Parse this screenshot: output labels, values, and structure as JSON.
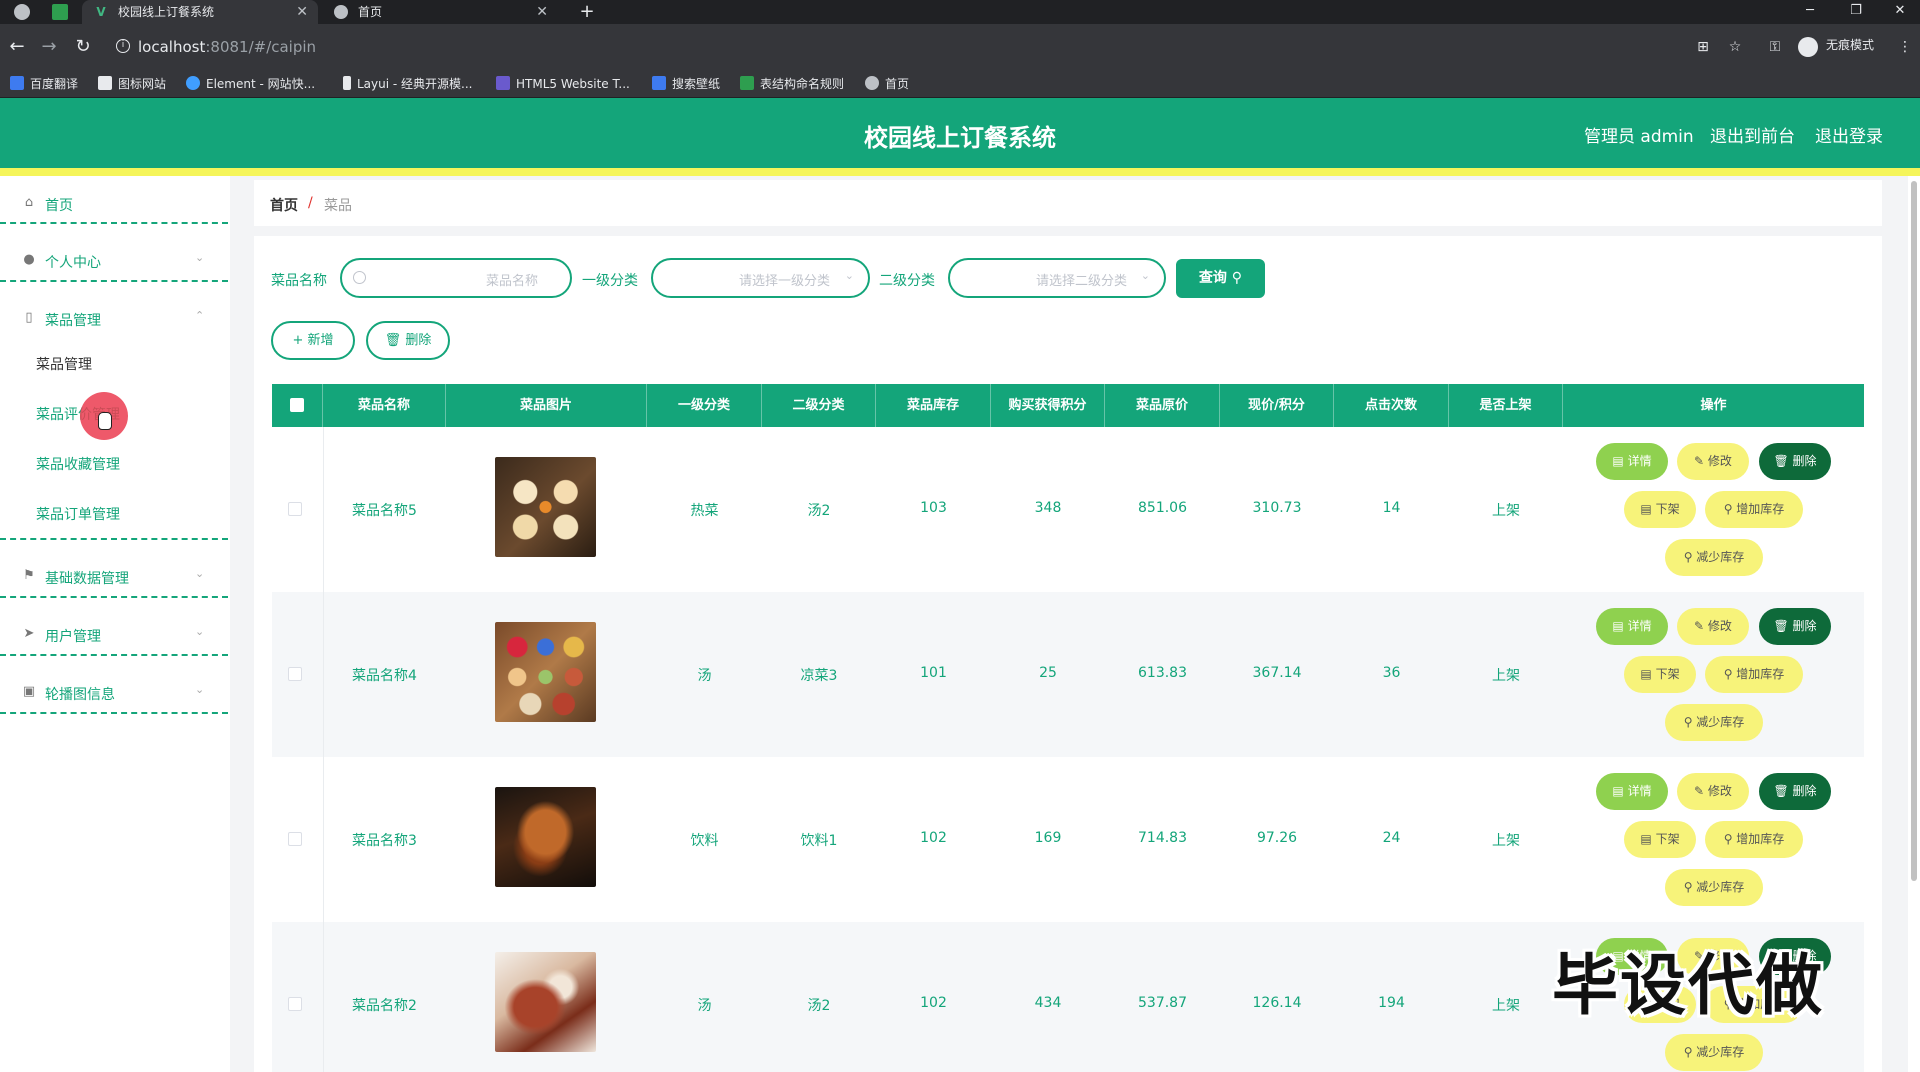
{
  "browser": {
    "tabs": [
      {
        "title": "校园线上订餐系统",
        "active": true
      },
      {
        "title": "首页",
        "active": false
      }
    ],
    "url_host": "localhost",
    "url_rest": ":8081/#/caipin",
    "incognito_label": "无痕模式",
    "bookmarks": [
      "百度翻译",
      "图标网站",
      "Element - 网站快...",
      "Layui - 经典开源模...",
      "HTML5 Website T...",
      "搜索壁纸",
      "表结构命名规则",
      "首页"
    ]
  },
  "header": {
    "title": "校园线上订餐系统",
    "admin": "管理员 admin",
    "to_front": "退出到前台",
    "logout": "退出登录"
  },
  "sidebar": {
    "items": [
      {
        "label": "首页",
        "icon": "home-icon"
      },
      {
        "label": "个人中心",
        "icon": "user-icon"
      },
      {
        "label": "菜品管理",
        "icon": "phone-icon"
      },
      {
        "label": "基础数据管理",
        "icon": "flag-icon"
      },
      {
        "label": "用户管理",
        "icon": "send-icon"
      },
      {
        "label": "轮播图信息",
        "icon": "trash-icon"
      }
    ],
    "sub_items": [
      "菜品管理",
      "菜品评价管理",
      "菜品收藏管理",
      "菜品订单管理"
    ]
  },
  "breadcrumb": {
    "home": "首页",
    "sep": "/",
    "current": "菜品"
  },
  "filters": {
    "name_label": "菜品名称",
    "name_placeholder": "菜品名称",
    "cat1_label": "一级分类",
    "cat1_placeholder": "请选择一级分类",
    "cat2_label": "二级分类",
    "cat2_placeholder": "请选择二级分类",
    "query": "查询"
  },
  "actions": {
    "add": "+ 新增",
    "delete": "删除"
  },
  "table": {
    "headers": [
      "菜品名称",
      "菜品图片",
      "一级分类",
      "二级分类",
      "菜品库存",
      "购买获得积分",
      "菜品原价",
      "现价/积分",
      "点击次数",
      "是否上架",
      "操作"
    ],
    "rows": [
      {
        "name": "菜品名称5",
        "cat1": "热菜",
        "cat2": "汤2",
        "stock": "103",
        "points": "348",
        "price": "851.06",
        "now": "310.73",
        "clicks": "14",
        "status": "上架"
      },
      {
        "name": "菜品名称4",
        "cat1": "汤",
        "cat2": "凉菜3",
        "stock": "101",
        "points": "25",
        "price": "613.83",
        "now": "367.14",
        "clicks": "36",
        "status": "上架"
      },
      {
        "name": "菜品名称3",
        "cat1": "饮料",
        "cat2": "饮料1",
        "stock": "102",
        "points": "169",
        "price": "714.83",
        "now": "97.26",
        "clicks": "24",
        "status": "上架"
      },
      {
        "name": "菜品名称2",
        "cat1": "汤",
        "cat2": "汤2",
        "stock": "102",
        "points": "434",
        "price": "537.87",
        "now": "126.14",
        "clicks": "194",
        "status": "上架"
      }
    ],
    "op_labels": {
      "detail": "详情",
      "edit": "修改",
      "del": "删除",
      "off": "下架",
      "add_stock": "增加库存",
      "reduce_stock": "减少库存"
    }
  },
  "watermark": "毕设代做",
  "colors": {
    "primary": "#14a57a",
    "accent_yellow": "#f5f55a",
    "detail_green": "#8fd14f",
    "dark_green": "#0e6a3a"
  }
}
